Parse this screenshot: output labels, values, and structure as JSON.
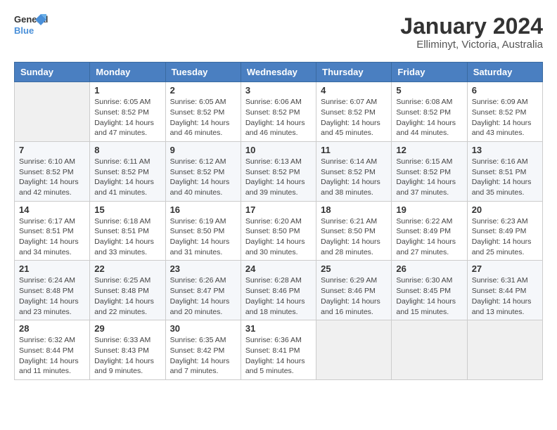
{
  "logo": {
    "line1": "General",
    "line2": "Blue"
  },
  "title": "January 2024",
  "subtitle": "Elliminyt, Victoria, Australia",
  "days_of_week": [
    "Sunday",
    "Monday",
    "Tuesday",
    "Wednesday",
    "Thursday",
    "Friday",
    "Saturday"
  ],
  "weeks": [
    [
      {
        "num": "",
        "sunrise": "",
        "sunset": "",
        "daylight": ""
      },
      {
        "num": "1",
        "sunrise": "Sunrise: 6:05 AM",
        "sunset": "Sunset: 8:52 PM",
        "daylight": "Daylight: 14 hours and 47 minutes."
      },
      {
        "num": "2",
        "sunrise": "Sunrise: 6:05 AM",
        "sunset": "Sunset: 8:52 PM",
        "daylight": "Daylight: 14 hours and 46 minutes."
      },
      {
        "num": "3",
        "sunrise": "Sunrise: 6:06 AM",
        "sunset": "Sunset: 8:52 PM",
        "daylight": "Daylight: 14 hours and 46 minutes."
      },
      {
        "num": "4",
        "sunrise": "Sunrise: 6:07 AM",
        "sunset": "Sunset: 8:52 PM",
        "daylight": "Daylight: 14 hours and 45 minutes."
      },
      {
        "num": "5",
        "sunrise": "Sunrise: 6:08 AM",
        "sunset": "Sunset: 8:52 PM",
        "daylight": "Daylight: 14 hours and 44 minutes."
      },
      {
        "num": "6",
        "sunrise": "Sunrise: 6:09 AM",
        "sunset": "Sunset: 8:52 PM",
        "daylight": "Daylight: 14 hours and 43 minutes."
      }
    ],
    [
      {
        "num": "7",
        "sunrise": "Sunrise: 6:10 AM",
        "sunset": "Sunset: 8:52 PM",
        "daylight": "Daylight: 14 hours and 42 minutes."
      },
      {
        "num": "8",
        "sunrise": "Sunrise: 6:11 AM",
        "sunset": "Sunset: 8:52 PM",
        "daylight": "Daylight: 14 hours and 41 minutes."
      },
      {
        "num": "9",
        "sunrise": "Sunrise: 6:12 AM",
        "sunset": "Sunset: 8:52 PM",
        "daylight": "Daylight: 14 hours and 40 minutes."
      },
      {
        "num": "10",
        "sunrise": "Sunrise: 6:13 AM",
        "sunset": "Sunset: 8:52 PM",
        "daylight": "Daylight: 14 hours and 39 minutes."
      },
      {
        "num": "11",
        "sunrise": "Sunrise: 6:14 AM",
        "sunset": "Sunset: 8:52 PM",
        "daylight": "Daylight: 14 hours and 38 minutes."
      },
      {
        "num": "12",
        "sunrise": "Sunrise: 6:15 AM",
        "sunset": "Sunset: 8:52 PM",
        "daylight": "Daylight: 14 hours and 37 minutes."
      },
      {
        "num": "13",
        "sunrise": "Sunrise: 6:16 AM",
        "sunset": "Sunset: 8:51 PM",
        "daylight": "Daylight: 14 hours and 35 minutes."
      }
    ],
    [
      {
        "num": "14",
        "sunrise": "Sunrise: 6:17 AM",
        "sunset": "Sunset: 8:51 PM",
        "daylight": "Daylight: 14 hours and 34 minutes."
      },
      {
        "num": "15",
        "sunrise": "Sunrise: 6:18 AM",
        "sunset": "Sunset: 8:51 PM",
        "daylight": "Daylight: 14 hours and 33 minutes."
      },
      {
        "num": "16",
        "sunrise": "Sunrise: 6:19 AM",
        "sunset": "Sunset: 8:50 PM",
        "daylight": "Daylight: 14 hours and 31 minutes."
      },
      {
        "num": "17",
        "sunrise": "Sunrise: 6:20 AM",
        "sunset": "Sunset: 8:50 PM",
        "daylight": "Daylight: 14 hours and 30 minutes."
      },
      {
        "num": "18",
        "sunrise": "Sunrise: 6:21 AM",
        "sunset": "Sunset: 8:50 PM",
        "daylight": "Daylight: 14 hours and 28 minutes."
      },
      {
        "num": "19",
        "sunrise": "Sunrise: 6:22 AM",
        "sunset": "Sunset: 8:49 PM",
        "daylight": "Daylight: 14 hours and 27 minutes."
      },
      {
        "num": "20",
        "sunrise": "Sunrise: 6:23 AM",
        "sunset": "Sunset: 8:49 PM",
        "daylight": "Daylight: 14 hours and 25 minutes."
      }
    ],
    [
      {
        "num": "21",
        "sunrise": "Sunrise: 6:24 AM",
        "sunset": "Sunset: 8:48 PM",
        "daylight": "Daylight: 14 hours and 23 minutes."
      },
      {
        "num": "22",
        "sunrise": "Sunrise: 6:25 AM",
        "sunset": "Sunset: 8:48 PM",
        "daylight": "Daylight: 14 hours and 22 minutes."
      },
      {
        "num": "23",
        "sunrise": "Sunrise: 6:26 AM",
        "sunset": "Sunset: 8:47 PM",
        "daylight": "Daylight: 14 hours and 20 minutes."
      },
      {
        "num": "24",
        "sunrise": "Sunrise: 6:28 AM",
        "sunset": "Sunset: 8:46 PM",
        "daylight": "Daylight: 14 hours and 18 minutes."
      },
      {
        "num": "25",
        "sunrise": "Sunrise: 6:29 AM",
        "sunset": "Sunset: 8:46 PM",
        "daylight": "Daylight: 14 hours and 16 minutes."
      },
      {
        "num": "26",
        "sunrise": "Sunrise: 6:30 AM",
        "sunset": "Sunset: 8:45 PM",
        "daylight": "Daylight: 14 hours and 15 minutes."
      },
      {
        "num": "27",
        "sunrise": "Sunrise: 6:31 AM",
        "sunset": "Sunset: 8:44 PM",
        "daylight": "Daylight: 14 hours and 13 minutes."
      }
    ],
    [
      {
        "num": "28",
        "sunrise": "Sunrise: 6:32 AM",
        "sunset": "Sunset: 8:44 PM",
        "daylight": "Daylight: 14 hours and 11 minutes."
      },
      {
        "num": "29",
        "sunrise": "Sunrise: 6:33 AM",
        "sunset": "Sunset: 8:43 PM",
        "daylight": "Daylight: 14 hours and 9 minutes."
      },
      {
        "num": "30",
        "sunrise": "Sunrise: 6:35 AM",
        "sunset": "Sunset: 8:42 PM",
        "daylight": "Daylight: 14 hours and 7 minutes."
      },
      {
        "num": "31",
        "sunrise": "Sunrise: 6:36 AM",
        "sunset": "Sunset: 8:41 PM",
        "daylight": "Daylight: 14 hours and 5 minutes."
      },
      {
        "num": "",
        "sunrise": "",
        "sunset": "",
        "daylight": ""
      },
      {
        "num": "",
        "sunrise": "",
        "sunset": "",
        "daylight": ""
      },
      {
        "num": "",
        "sunrise": "",
        "sunset": "",
        "daylight": ""
      }
    ]
  ]
}
